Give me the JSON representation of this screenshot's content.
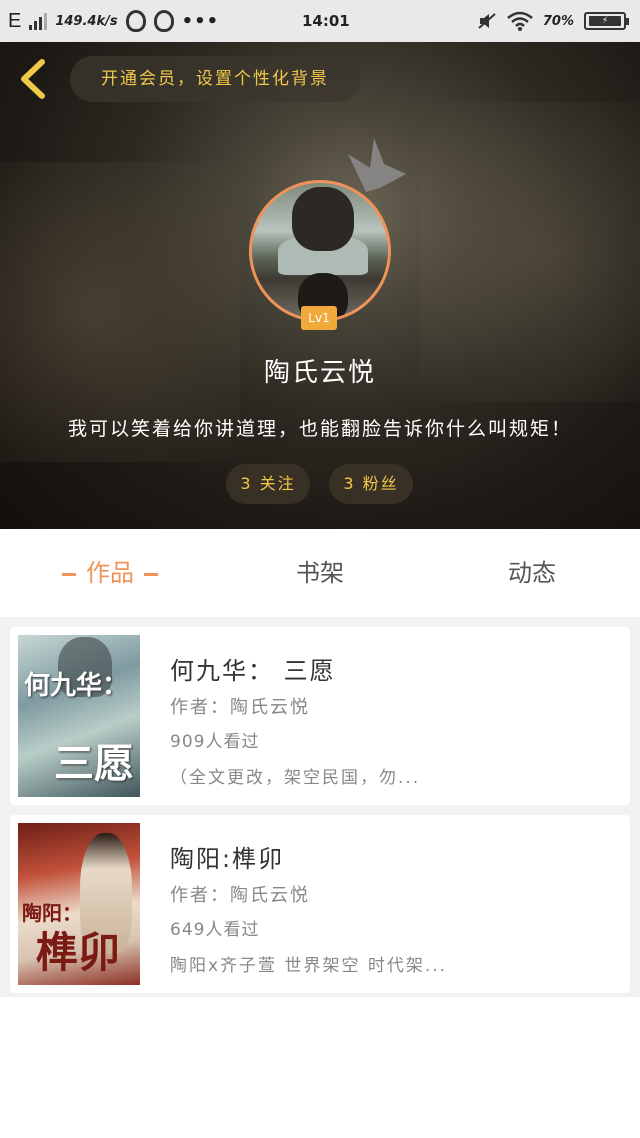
{
  "status_bar": {
    "network": "E",
    "speed": "149.4k/s",
    "time": "14:01",
    "battery": "70%"
  },
  "header": {
    "vip_prompt": "开通会员，设置个性化背景",
    "level": "Lv1",
    "username": "陶氏云悦",
    "bio": "我可以笑着给你讲道理，也能翻脸告诉你什么叫规矩！",
    "following": "3 关注",
    "fans": "3 粉丝",
    "accent_color": "#f0c84a",
    "ring_color": "#f0935a"
  },
  "tabs": [
    {
      "label": "作品",
      "active": true
    },
    {
      "label": "书架",
      "active": false
    },
    {
      "label": "动态",
      "active": false
    }
  ],
  "books": [
    {
      "title": "何九华： 三愿",
      "author": "作者：陶氏云悦",
      "reads": "909人看过",
      "desc": "（全文更改，架空民国，勿...",
      "cover_text_a": "何九华：",
      "cover_text_b": "三愿"
    },
    {
      "title": "陶阳:榫卯",
      "author": "作者：陶氏云悦",
      "reads": "649人看过",
      "desc": "陶阳x齐子萱 世界架空  时代架...",
      "cover_text_a": "陶阳：",
      "cover_text_b": "榫卯"
    }
  ]
}
